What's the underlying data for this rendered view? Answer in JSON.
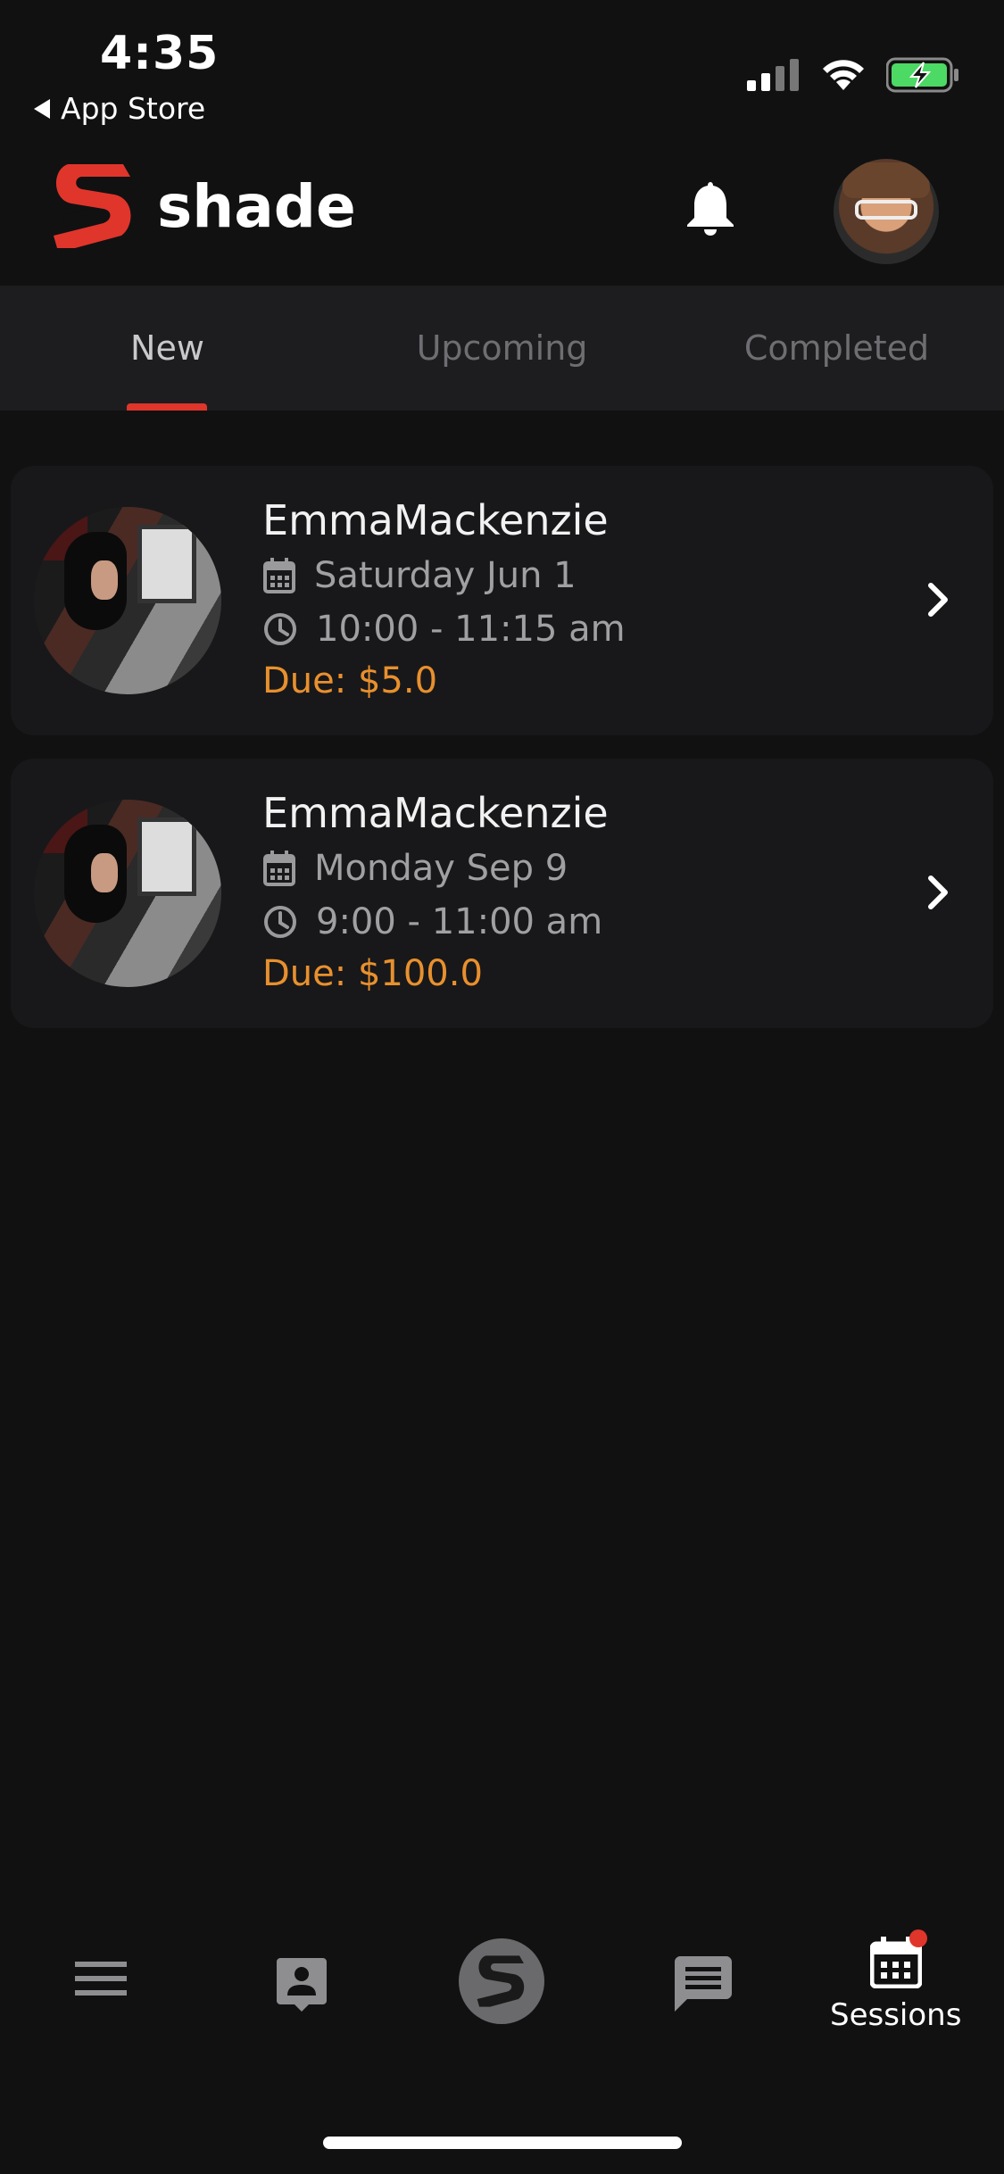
{
  "status_bar": {
    "time": "4:35",
    "back_label": "App Store",
    "icons": [
      "signal-icon",
      "wifi-icon",
      "battery-charging-icon"
    ]
  },
  "header": {
    "app_name": "shade",
    "icons": [
      "shade-logo-icon",
      "bell-icon",
      "profile-avatar"
    ]
  },
  "tabs": [
    {
      "label": "New",
      "active": true
    },
    {
      "label": "Upcoming",
      "active": false
    },
    {
      "label": "Completed",
      "active": false
    }
  ],
  "sessions": [
    {
      "name": "EmmaMackenzie",
      "date": "Saturday Jun 1",
      "time": "10:00 - 11:15 am",
      "due": "Due: $5.0"
    },
    {
      "name": "EmmaMackenzie",
      "date": "Monday Sep 9",
      "time": "9:00 - 11:00 am",
      "due": "Due: $100.0"
    }
  ],
  "bottom_nav": {
    "items": [
      {
        "icon": "menu-icon"
      },
      {
        "icon": "contact-card-icon"
      },
      {
        "icon": "shade-home-icon"
      },
      {
        "icon": "chat-icon"
      },
      {
        "icon": "calendar-icon",
        "label": "Sessions",
        "has_badge": true
      }
    ]
  },
  "colors": {
    "accent": "#e0352b",
    "due": "#e8902e",
    "background": "#111112",
    "card": "#18181a",
    "tab_bar": "#1d1d1f"
  }
}
